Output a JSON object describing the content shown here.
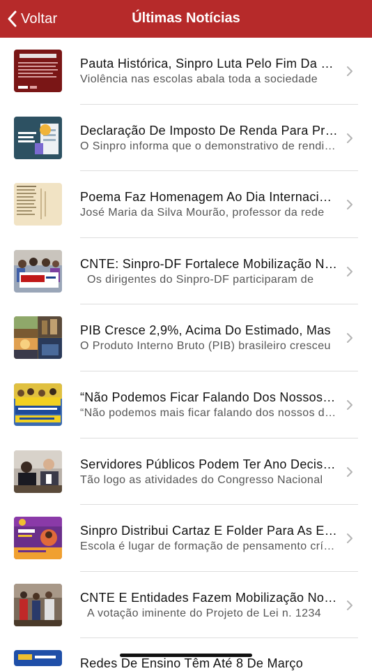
{
  "nav": {
    "back_label": "Voltar",
    "title": "Últimas Notícias",
    "bar_color": "#b62a2a"
  },
  "news": [
    {
      "title": "Pauta Histórica, Sinpro Luta Pelo Fim Da Violência Nas Escolas",
      "subtitle": "Violência nas escolas abala toda a sociedade",
      "thumb": "nota-do-sinpro-image"
    },
    {
      "title": "Declaração De Imposto De Renda Para Professores",
      "subtitle": "O Sinpro informa que o demonstrativo de rendimentos",
      "thumb": "tax-document-image"
    },
    {
      "title": "Poema Faz Homenagem Ao Dia Internacional Da Mulher",
      "subtitle": "José Maria da Silva Mourão, professor da rede",
      "thumb": "poem-image"
    },
    {
      "title": "CNTE: Sinpro-DF Fortalece Mobilização Nacional",
      "subtitle": "Os dirigentes do Sinpro-DF participaram de",
      "thumb": "cnte-protest-image"
    },
    {
      "title": "PIB Cresce 2,9%, Acima Do Estimado, Mas",
      "subtitle": "O Produto Interno Bruto (PIB) brasileiro cresceu",
      "thumb": "pib-collage-image"
    },
    {
      "title": "“Não Podemos Ficar Falando Dos Nossos Direitos”",
      "subtitle": "“Não podemos mais ficar falando dos nossos direitos",
      "thumb": "correios-protest-image"
    },
    {
      "title": "Servidores Públicos Podem Ter Ano Decisivo",
      "subtitle": "Tão logo as atividades do Congresso Nacional",
      "thumb": "congress-meeting-image"
    },
    {
      "title": "Sinpro Distribui Cartaz E Folder Para As Escolas",
      "subtitle": "Escola é lugar de formação de pensamento crítico",
      "thumb": "mulheres-poster-image"
    },
    {
      "title": "CNTE E Entidades Fazem Mobilização No Congresso",
      "subtitle": "A votação iminente do Projeto de Lei n. 1234",
      "thumb": "group-photo-image"
    },
    {
      "title": "Redes De Ensino Têm Até 8 De Março",
      "subtitle": "",
      "thumb": "partial-image"
    }
  ]
}
